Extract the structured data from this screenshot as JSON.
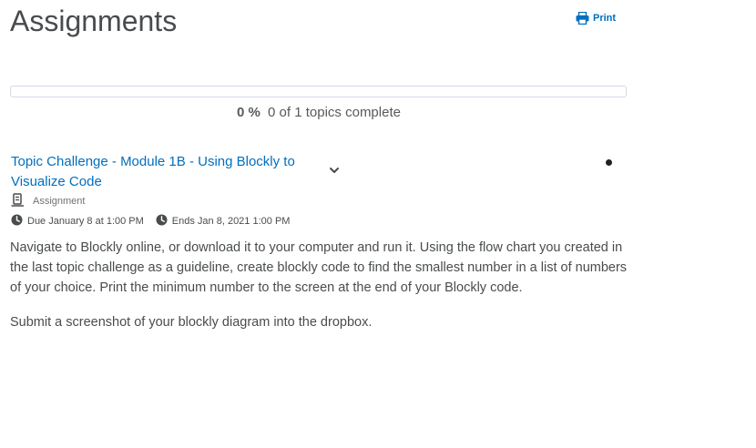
{
  "page": {
    "title": "Assignments",
    "print_label": "Print"
  },
  "progress": {
    "percent_label": "0 %",
    "summary": "0 of 1 topics complete",
    "fraction_complete": 0
  },
  "topic": {
    "title": "Topic Challenge - Module 1B - Using Blockly to Visualize Code",
    "type_label": "Assignment",
    "due": "Due January 8 at 1:00 PM",
    "ends": "Ends Jan 8, 2021 1:00 PM",
    "description": [
      "Navigate to Blockly online, or download it to your computer and run it. Using the flow chart you created in the last topic challenge as a guideline, create blockly code to find the smallest number in a list of numbers of your choice. Print the minimum number to the screen at the end of your Blockly code.",
      "Submit a screenshot of your blockly diagram into the dropbox."
    ]
  },
  "icons": {
    "print": "printer-icon",
    "expand": "chevron-down-icon",
    "status": "unread-dot-icon",
    "type": "assignment-icon",
    "due": "clock-icon",
    "ends": "clock-icon"
  },
  "colors": {
    "link": "#006fbf",
    "text": "#494c4e",
    "progress_border": "#d3d9e3"
  }
}
